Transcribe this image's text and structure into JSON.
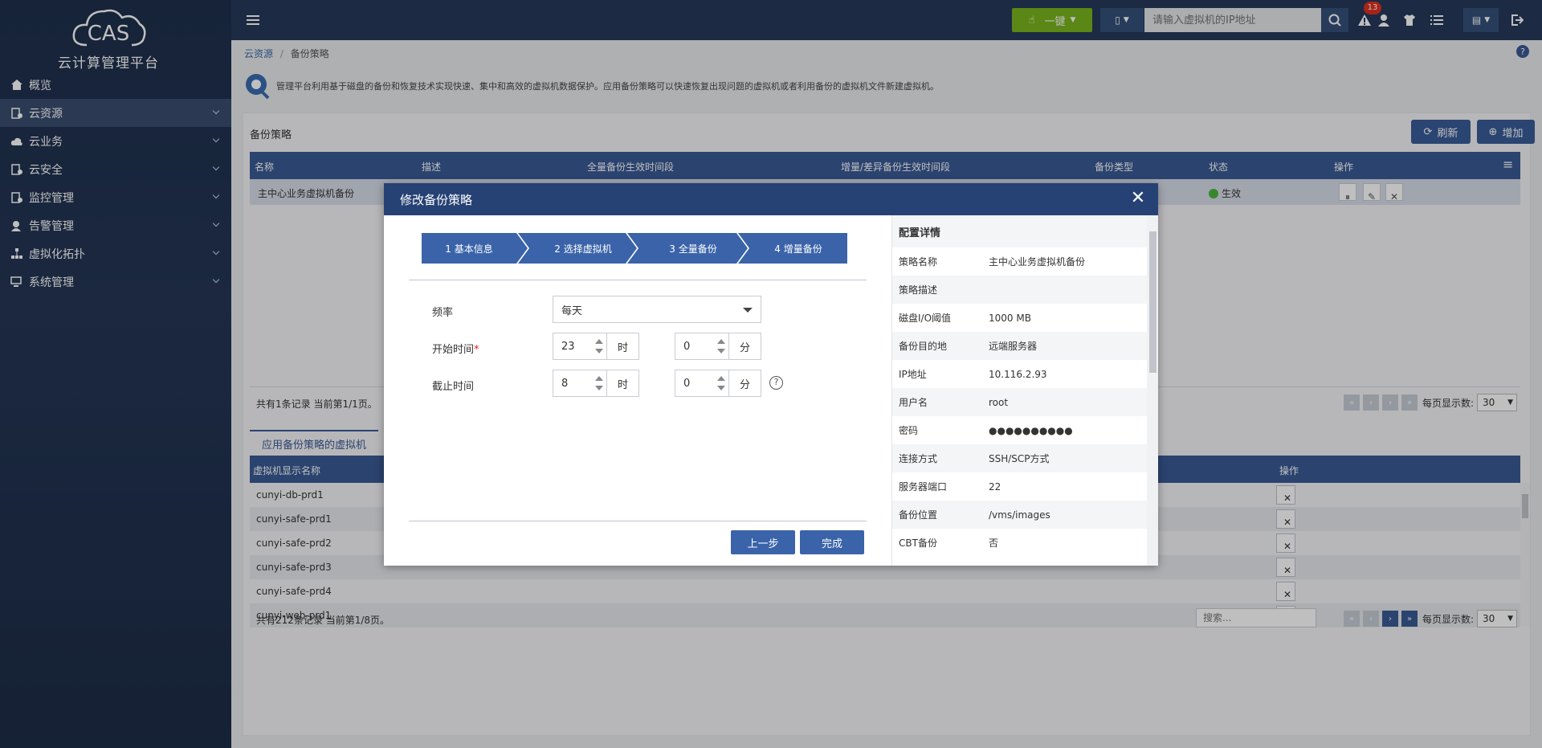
{
  "app": {
    "brand_title": "云计算管理平台",
    "logo_text": "CAS"
  },
  "sidebar": {
    "items": [
      {
        "label": "概览",
        "icon": "home-icon"
      },
      {
        "label": "云资源",
        "icon": "resource-icon"
      },
      {
        "label": "云业务",
        "icon": "cloud-icon"
      },
      {
        "label": "云安全",
        "icon": "security-icon"
      },
      {
        "label": "监控管理",
        "icon": "monitor-icon"
      },
      {
        "label": "告警管理",
        "icon": "alarm-icon"
      },
      {
        "label": "虚拟化拓扑",
        "icon": "topology-icon"
      },
      {
        "label": "系统管理",
        "icon": "system-icon"
      }
    ]
  },
  "topbar": {
    "onekey_label": "一键",
    "search_placeholder": "请输入虚拟机的IP地址",
    "alert_count": "13"
  },
  "breadcrumb": {
    "root": "云资源",
    "sep": "/",
    "current": "备份策略"
  },
  "intro_text": "管理平台利用基于磁盘的备份和恢复技术实现快速、集中和高效的虚拟机数据保护。应用备份策略可以快速恢复出现问题的虚拟机或者利用备份的虚拟机文件新建虚拟机。",
  "policy_panel": {
    "title": "备份策略",
    "refresh_label": "刷新",
    "add_label": "增加",
    "columns": [
      "名称",
      "描述",
      "全量备份生效时间段",
      "增量/差异备份生效时间段",
      "备份类型",
      "状态",
      "操作"
    ],
    "row": {
      "name": "主中心业务虚拟机备份",
      "status": "生效"
    },
    "summary": "共有1条记录 当前第1/1页。",
    "page_size_label": "每页显示数:",
    "page_size": "30"
  },
  "vm_panel": {
    "tab": "应用备份策略的虚拟机",
    "columns": [
      "虚拟机显示名称",
      "操作"
    ],
    "rows": [
      "cunyi-db-prd1",
      "cunyi-safe-prd1",
      "cunyi-safe-prd2",
      "cunyi-safe-prd3",
      "cunyi-safe-prd4",
      "cunyi-web-prd1"
    ],
    "summary": "共有212条记录 当前第1/8页。",
    "search_placeholder": "搜索...",
    "page_size_label": "每页显示数:",
    "page_size": "30"
  },
  "modal": {
    "title": "修改备份策略",
    "steps": [
      "1 基本信息",
      "2 选择虚拟机",
      "3 全量备份",
      "4 增量备份"
    ],
    "form": {
      "frequency_label": "频率",
      "frequency_value": "每天",
      "start_label": "开始时间",
      "start_required": "*",
      "start_hour": "23",
      "start_minute": "0",
      "end_label": "截止时间",
      "end_hour": "8",
      "end_minute": "0",
      "hour_unit": "时",
      "minute_unit": "分"
    },
    "prev_label": "上一步",
    "finish_label": "完成",
    "detail": {
      "title": "配置详情",
      "rows": [
        {
          "k": "策略名称",
          "v": "主中心业务虚拟机备份"
        },
        {
          "k": "策略描述",
          "v": ""
        },
        {
          "k": "磁盘I/O阈值",
          "v": "1000 MB"
        },
        {
          "k": "备份目的地",
          "v": "远端服务器"
        },
        {
          "k": "IP地址",
          "v": "10.116.2.93"
        },
        {
          "k": "用户名",
          "v": "root"
        },
        {
          "k": "密码",
          "v": "●●●●●●●●●●"
        },
        {
          "k": "连接方式",
          "v": "SSH/SCP方式"
        },
        {
          "k": "服务器端口",
          "v": "22"
        },
        {
          "k": "备份位置",
          "v": "/vms/images"
        },
        {
          "k": "CBT备份",
          "v": "否"
        }
      ]
    }
  }
}
